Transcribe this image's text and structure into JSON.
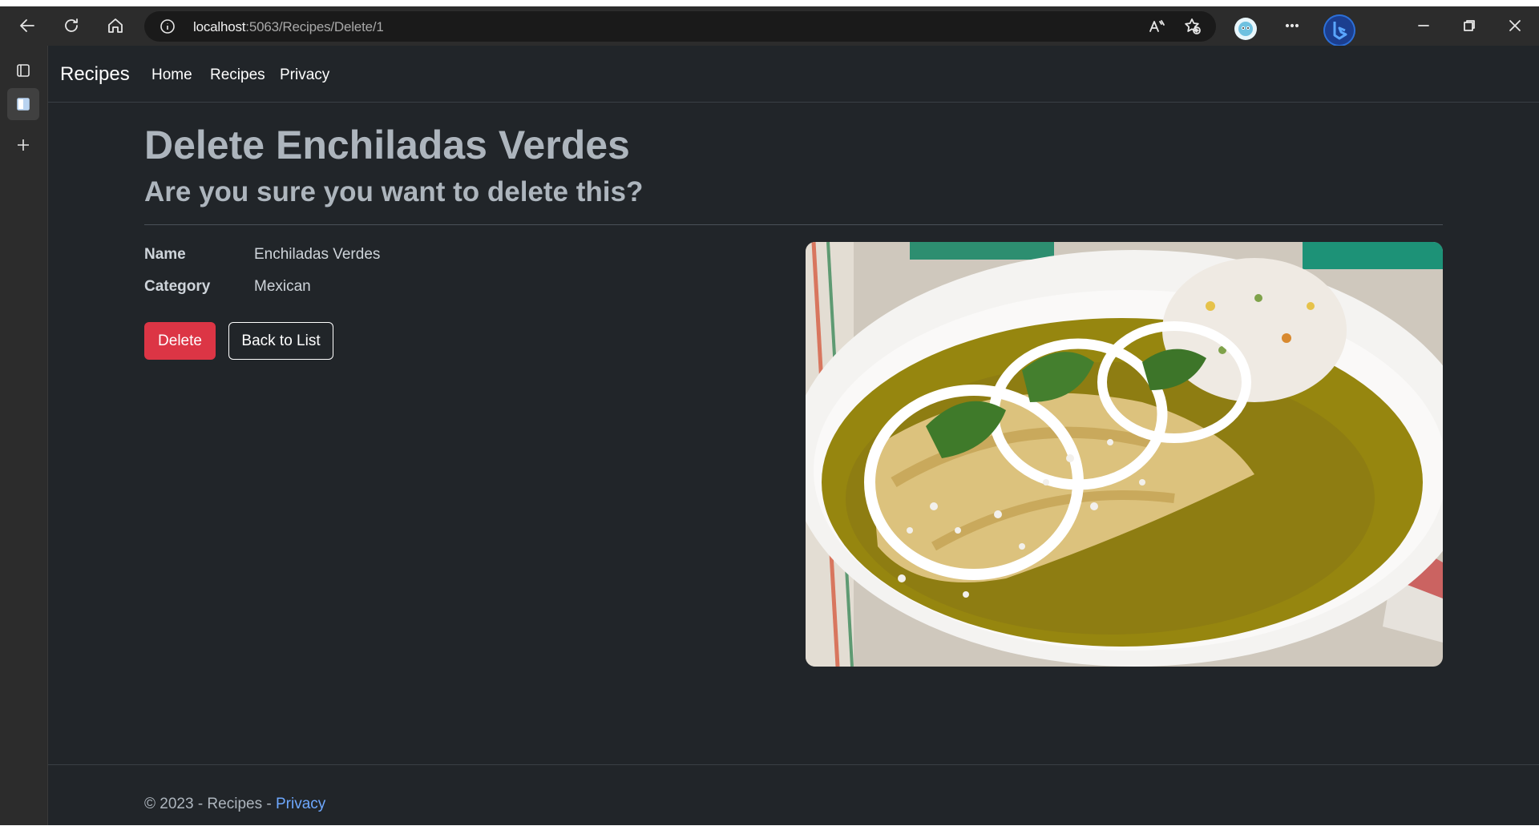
{
  "browser": {
    "url_host": "localhost",
    "url_path": ":5063/Recipes/Delete/1"
  },
  "app": {
    "brand": "Recipes",
    "nav": [
      {
        "label": "Home"
      },
      {
        "label": "Recipes"
      },
      {
        "label": "Privacy"
      }
    ]
  },
  "main": {
    "title": "Delete Enchiladas Verdes",
    "subtitle": "Are you sure you want to delete this?",
    "details": [
      {
        "term": "Name",
        "value": "Enchiladas Verdes"
      },
      {
        "term": "Category",
        "value": "Mexican"
      }
    ],
    "delete_label": "Delete",
    "back_label": "Back to List"
  },
  "footer": {
    "text": "© 2023 - Recipes - ",
    "link": "Privacy"
  },
  "colors": {
    "page_bg": "#212529",
    "danger": "#dc3545",
    "link": "#6ea8fe"
  }
}
